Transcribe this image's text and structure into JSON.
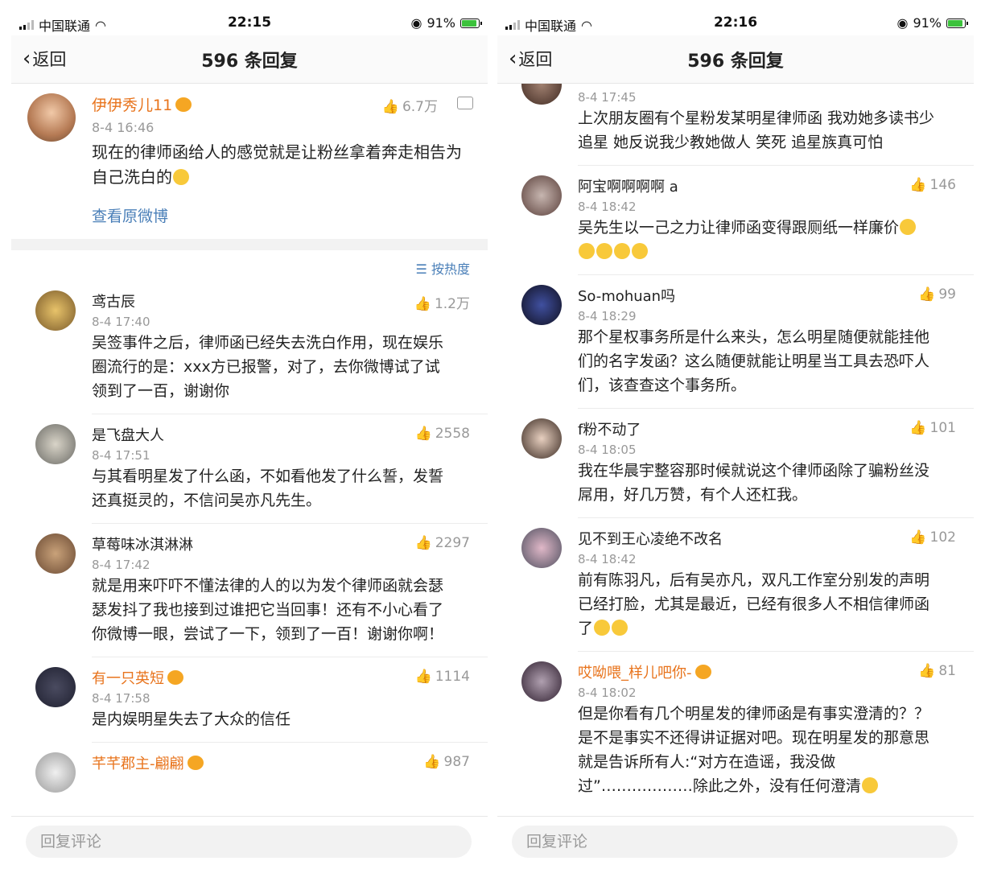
{
  "screens": [
    {
      "status": {
        "carrier": "中国联通",
        "time": "22:15",
        "battery": "91%"
      },
      "nav": {
        "back": "返回",
        "title": "596 条回复"
      },
      "original": {
        "name": "伊伊秀儿11",
        "time": "8-4 16:46",
        "likes": "6.7万",
        "text": "现在的律师函给人的感觉就是让粉丝拿着奔走相告为自己洗白的",
        "link": "查看原微博"
      },
      "sort": "按热度",
      "comments": [
        {
          "name": "鸢古辰",
          "time": "8-4 17:40",
          "likes": "1.2万",
          "text": "吴签事件之后，律师函已经失去洗白作用，现在娱乐圈流行的是：xxx方已报警，对了，去你微博试了试领到了一百，谢谢你"
        },
        {
          "name": "是飞盘大人",
          "time": "8-4 17:51",
          "likes": "2558",
          "text": "与其看明星发了什么函，不如看他发了什么誓，发誓还真挺灵的，不信问吴亦凡先生。"
        },
        {
          "name": "草莓味冰淇淋淋",
          "time": "8-4 17:42",
          "likes": "2297",
          "text": "就是用来吓吓不懂法律的人的以为发个律师函就会瑟瑟发抖了我也接到过谁把它当回事！还有不小心看了你微博一眼，尝试了一下，领到了一百！谢谢你啊！"
        },
        {
          "name": "有一只英短",
          "time": "8-4 17:58",
          "likes": "1114",
          "text": "是内娱明星失去了大众的信任"
        },
        {
          "name": "芊芊郡主-翩翩",
          "time": "",
          "likes": "987",
          "text": ""
        }
      ],
      "reply_placeholder": "回复评论"
    },
    {
      "status": {
        "carrier": "中国联通",
        "time": "22:16",
        "battery": "91%"
      },
      "nav": {
        "back": "返回",
        "title": "596 条回复"
      },
      "comments": [
        {
          "name": "",
          "time": "8-4 17:45",
          "likes": "",
          "text": "上次朋友圈有个星粉发某明星律师函 我劝她多读书少追星 她反说我少教她做人 笑死 追星族真可怕"
        },
        {
          "name": "阿宝啊啊啊啊 a",
          "time": "8-4 18:42",
          "likes": "146",
          "text": "吴先生以一己之力让律师函变得跟厕纸一样廉价"
        },
        {
          "name": "So-mohuan吗",
          "time": "8-4 18:29",
          "likes": "99",
          "text": "那个星权事务所是什么来头，怎么明星随便就能挂他们的名字发函？这么随便就能让明星当工具去恐吓人们，该查查这个事务所。"
        },
        {
          "name": "f粉不动了",
          "time": "8-4 18:05",
          "likes": "101",
          "text": "我在华晨宇整容那时候就说这个律师函除了骗粉丝没屌用，好几万赞，有个人还杠我。"
        },
        {
          "name": "见不到王心凌绝不改名",
          "time": "8-4 18:42",
          "likes": "102",
          "text": "前有陈羽凡，后有吴亦凡，双凡工作室分别发的声明已经打脸，尤其是最近，已经有很多人不相信律师函了"
        },
        {
          "name": "哎呦喂_样儿吧你-",
          "time": "8-4 18:02",
          "likes": "81",
          "text": "但是你看有几个明星发的律师函是有事实澄清的？？是不是事实不还得讲证据对吧。现在明星发的那意思就是告诉所有人:“对方在造谣，我没做过”………………除此之外，没有任何澄清"
        }
      ],
      "reply_placeholder": "回复评论"
    }
  ]
}
